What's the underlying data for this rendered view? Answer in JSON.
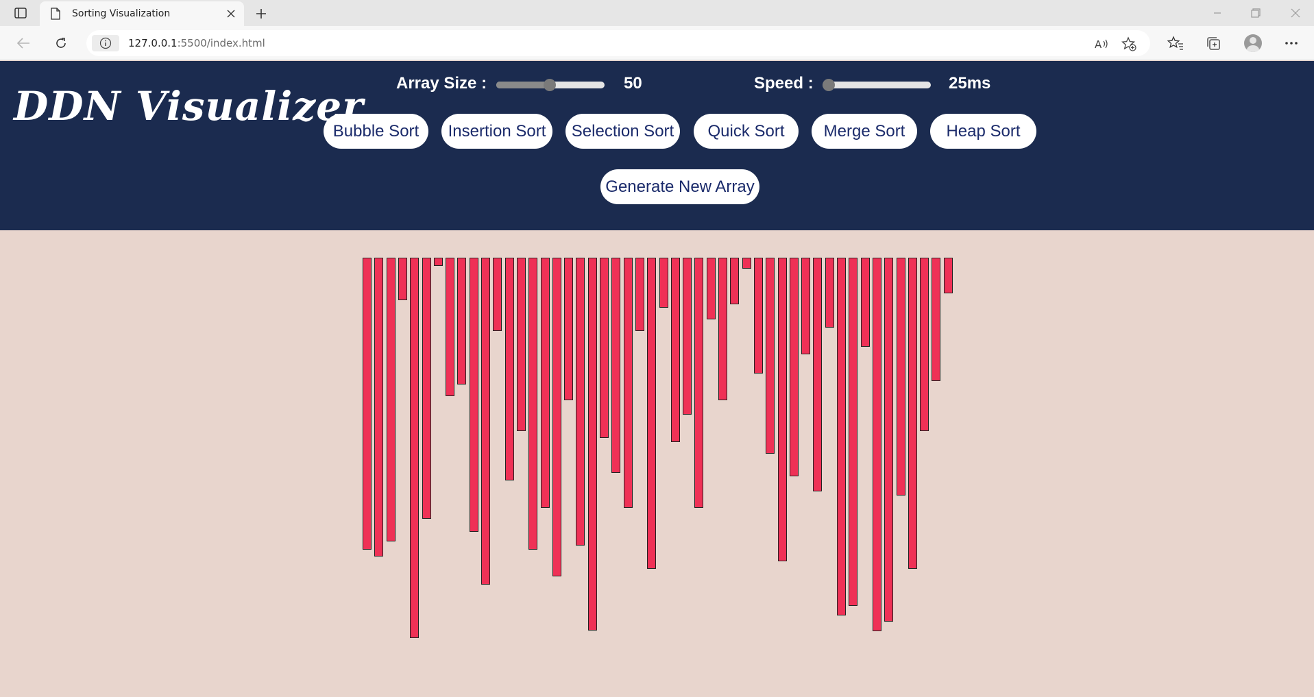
{
  "browser": {
    "tab_title": "Sorting Visualization",
    "url_host": "127.0.0.1",
    "url_rest": ":5500/index.html"
  },
  "app": {
    "logo": "DDN Visualizer",
    "array_size_label": "Array Size :",
    "array_size_value": "50",
    "array_size_fraction": 0.49,
    "speed_label": "Speed :",
    "speed_value": "25ms",
    "speed_fraction": 0.0,
    "bar_color": "#ef3156",
    "header_color": "#1b2b4f",
    "background_color": "#e8d5cd",
    "sort_buttons": [
      "Bubble Sort",
      "Insertion Sort",
      "Selection Sort",
      "Quick Sort",
      "Merge Sort",
      "Heap Sort"
    ],
    "generate_button": "Generate New Array"
  },
  "array_values": [
    426,
    436,
    414,
    62,
    555,
    381,
    12,
    202,
    185,
    400,
    477,
    107,
    325,
    253,
    426,
    365,
    465,
    208,
    420,
    544,
    263,
    314,
    365,
    107,
    454,
    73,
    269,
    229,
    365,
    90,
    208,
    68,
    16,
    169,
    286,
    443,
    319,
    141,
    341,
    102,
    522,
    508,
    130,
    545,
    531,
    347,
    454,
    253,
    180,
    52
  ]
}
